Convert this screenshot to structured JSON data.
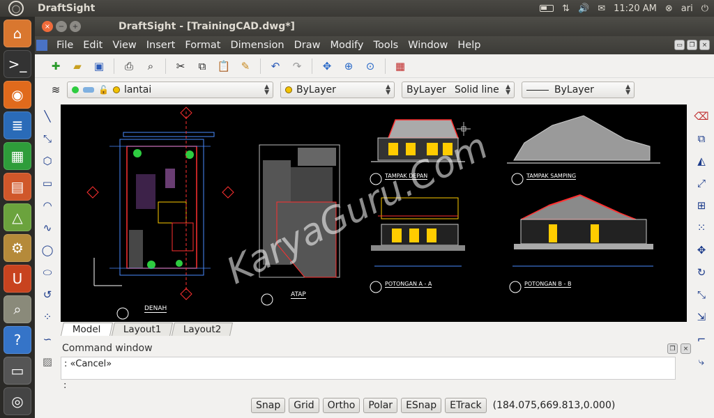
{
  "system_panel": {
    "app_name": "DraftSight",
    "time": "11:20 AM",
    "user": "ari"
  },
  "window": {
    "title": "DraftSight - [TrainingCAD.dwg*]",
    "close_glyph": "×",
    "min_glyph": "−",
    "max_glyph": "+"
  },
  "menu": {
    "items": [
      "File",
      "Edit",
      "View",
      "Insert",
      "Format",
      "Dimension",
      "Draw",
      "Modify",
      "Tools",
      "Window",
      "Help"
    ]
  },
  "toolbar": {
    "icons": [
      "new-icon",
      "open-icon",
      "save-icon",
      "print-icon",
      "print-preview-icon",
      "cut-icon",
      "copy-icon",
      "paste-icon",
      "match-properties-icon",
      "undo-icon",
      "redo-icon",
      "pan-icon",
      "zoom-icon",
      "zoom-window-icon",
      "color-icon"
    ]
  },
  "properties": {
    "layer": "lantai",
    "color": "ByLayer",
    "linestyle_layer": "ByLayer",
    "linestyle": "Solid line",
    "lineweight": "ByLayer"
  },
  "drawing_labels": {
    "denah": "DENAH",
    "atap": "ATAP",
    "tampak_depan": "TAMPAK DEPAN",
    "tampak_samping": "TAMPAK SAMPING",
    "potongan_a": "POTONGAN A - A",
    "potongan_b": "POTONGAN B - B",
    "watermark": "KaryaGuru.Com"
  },
  "layout_tabs": [
    "Model",
    "Layout1",
    "Layout2"
  ],
  "command_window": {
    "title": "Command window",
    "history": ": «Cancel»",
    "prompt": ":"
  },
  "status": {
    "buttons": [
      "Snap",
      "Grid",
      "Ortho",
      "Polar",
      "ESnap",
      "ETrack"
    ],
    "coordinates": "(184.075,669.813,0.000)"
  }
}
